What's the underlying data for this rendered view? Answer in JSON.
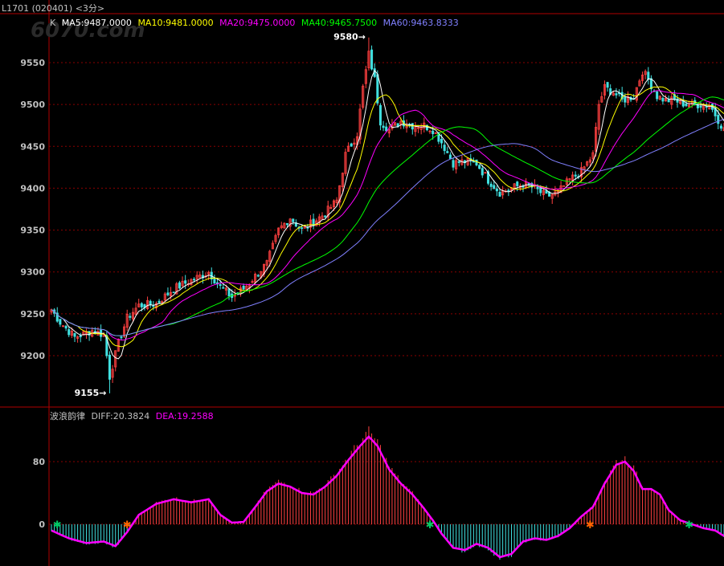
{
  "header": {
    "symbol": "L1701 (020401) <3分>",
    "chart_code": "K",
    "ma5": "MA5:9487.0000",
    "ma10": "MA10:9481.0000",
    "ma20": "MA20:9475.0000",
    "ma40": "MA40:9465.7500",
    "ma60": "MA60:9463.8333"
  },
  "macd_header": {
    "name": "波浪韵律",
    "diff": "DIFF:20.3824",
    "dea": "DEA:19.2588"
  },
  "annotations": {
    "high": "9580",
    "low": "9155"
  },
  "watermark": "6070.com",
  "colors": {
    "background": "#000000",
    "grid": "#8b0000",
    "axis": "#b00000",
    "up": "#ff4040",
    "down": "#40e0e0",
    "ma5": "#ffffff",
    "ma10": "#ffff00",
    "ma20": "#ff00ff",
    "ma40": "#00ff00",
    "ma60": "#8080ff",
    "dea": "#ff00ff",
    "buy_mark": "#ff6600",
    "sell_mark": "#00cc66"
  },
  "chart_data": [
    {
      "type": "candlestick",
      "title": "",
      "ylim": [
        9145,
        9600
      ],
      "y_ticks": [
        "9550",
        "9500",
        "9450",
        "9400",
        "9350",
        "9300",
        "9250",
        "9200"
      ],
      "y_tick_values": [
        9550,
        9500,
        9450,
        9400,
        9350,
        9300,
        9250,
        9200
      ],
      "grid": true,
      "close_anchors": [
        [
          0,
          9255
        ],
        [
          3,
          9240
        ],
        [
          8,
          9222
        ],
        [
          14,
          9230
        ],
        [
          18,
          9225
        ],
        [
          20,
          9175
        ],
        [
          23,
          9215
        ],
        [
          26,
          9245
        ],
        [
          30,
          9260
        ],
        [
          36,
          9262
        ],
        [
          42,
          9280
        ],
        [
          48,
          9290
        ],
        [
          54,
          9300
        ],
        [
          58,
          9282
        ],
        [
          62,
          9270
        ],
        [
          66,
          9280
        ],
        [
          70,
          9295
        ],
        [
          74,
          9310
        ],
        [
          78,
          9350
        ],
        [
          82,
          9365
        ],
        [
          86,
          9350
        ],
        [
          90,
          9360
        ],
        [
          94,
          9370
        ],
        [
          98,
          9385
        ],
        [
          101,
          9440
        ],
        [
          105,
          9465
        ],
        [
          107,
          9520
        ],
        [
          109,
          9560
        ],
        [
          111,
          9530
        ],
        [
          113,
          9480
        ],
        [
          116,
          9470
        ],
        [
          120,
          9480
        ],
        [
          124,
          9475
        ],
        [
          128,
          9475
        ],
        [
          131,
          9470
        ],
        [
          134,
          9455
        ],
        [
          138,
          9430
        ],
        [
          142,
          9432
        ],
        [
          146,
          9430
        ],
        [
          150,
          9410
        ],
        [
          154,
          9395
        ],
        [
          158,
          9400
        ],
        [
          162,
          9405
        ],
        [
          166,
          9400
        ],
        [
          170,
          9390
        ],
        [
          174,
          9395
        ],
        [
          178,
          9410
        ],
        [
          182,
          9420
        ],
        [
          186,
          9440
        ],
        [
          188,
          9500
        ],
        [
          190,
          9520
        ],
        [
          193,
          9515
        ],
        [
          196,
          9505
        ],
        [
          200,
          9510
        ],
        [
          203,
          9540
        ],
        [
          205,
          9530
        ],
        [
          208,
          9510
        ],
        [
          211,
          9505
        ],
        [
          214,
          9505
        ],
        [
          218,
          9500
        ],
        [
          222,
          9500
        ],
        [
          226,
          9500
        ],
        [
          231,
          9470
        ]
      ],
      "series": [
        {
          "name": "MA5",
          "value": 9487.0
        },
        {
          "name": "MA10",
          "value": 9481.0
        },
        {
          "name": "MA20",
          "value": 9475.0
        },
        {
          "name": "MA40",
          "value": 9465.75
        },
        {
          "name": "MA60",
          "value": 9463.8333
        }
      ],
      "annotations": [
        {
          "label": "9580",
          "y": 9580
        },
        {
          "label": "9155",
          "y": 9155
        }
      ]
    },
    {
      "type": "bar",
      "title": "波浪韵律",
      "ylim": [
        -45,
        125
      ],
      "y_ticks": [
        "80",
        "0"
      ],
      "y_tick_values": [
        80,
        0
      ],
      "dea_anchors": [
        [
          0,
          -8
        ],
        [
          6,
          -18
        ],
        [
          12,
          -24
        ],
        [
          18,
          -22
        ],
        [
          22,
          -28
        ],
        [
          26,
          -10
        ],
        [
          30,
          12
        ],
        [
          36,
          26
        ],
        [
          42,
          32
        ],
        [
          48,
          28
        ],
        [
          54,
          32
        ],
        [
          58,
          12
        ],
        [
          62,
          2
        ],
        [
          66,
          3
        ],
        [
          70,
          22
        ],
        [
          74,
          42
        ],
        [
          78,
          52
        ],
        [
          82,
          48
        ],
        [
          86,
          40
        ],
        [
          90,
          38
        ],
        [
          94,
          48
        ],
        [
          98,
          62
        ],
        [
          102,
          82
        ],
        [
          106,
          100
        ],
        [
          109,
          112
        ],
        [
          112,
          100
        ],
        [
          116,
          70
        ],
        [
          120,
          52
        ],
        [
          124,
          38
        ],
        [
          128,
          20
        ],
        [
          131,
          5
        ],
        [
          134,
          -12
        ],
        [
          138,
          -30
        ],
        [
          142,
          -33
        ],
        [
          146,
          -25
        ],
        [
          150,
          -30
        ],
        [
          154,
          -42
        ],
        [
          158,
          -38
        ],
        [
          162,
          -22
        ],
        [
          166,
          -18
        ],
        [
          170,
          -20
        ],
        [
          174,
          -15
        ],
        [
          178,
          -5
        ],
        [
          182,
          10
        ],
        [
          186,
          22
        ],
        [
          190,
          52
        ],
        [
          194,
          76
        ],
        [
          197,
          80
        ],
        [
          200,
          68
        ],
        [
          203,
          45
        ],
        [
          206,
          45
        ],
        [
          209,
          38
        ],
        [
          212,
          18
        ],
        [
          216,
          5
        ],
        [
          220,
          0
        ],
        [
          224,
          -5
        ],
        [
          228,
          -8
        ],
        [
          231,
          -15
        ]
      ],
      "series": [
        {
          "name": "DIFF",
          "value": 20.3824
        },
        {
          "name": "DEA",
          "value": 19.2588
        }
      ],
      "buy_marks_at_bar": [
        26,
        185
      ],
      "sell_marks_at_bar": [
        2,
        130,
        219
      ]
    }
  ]
}
